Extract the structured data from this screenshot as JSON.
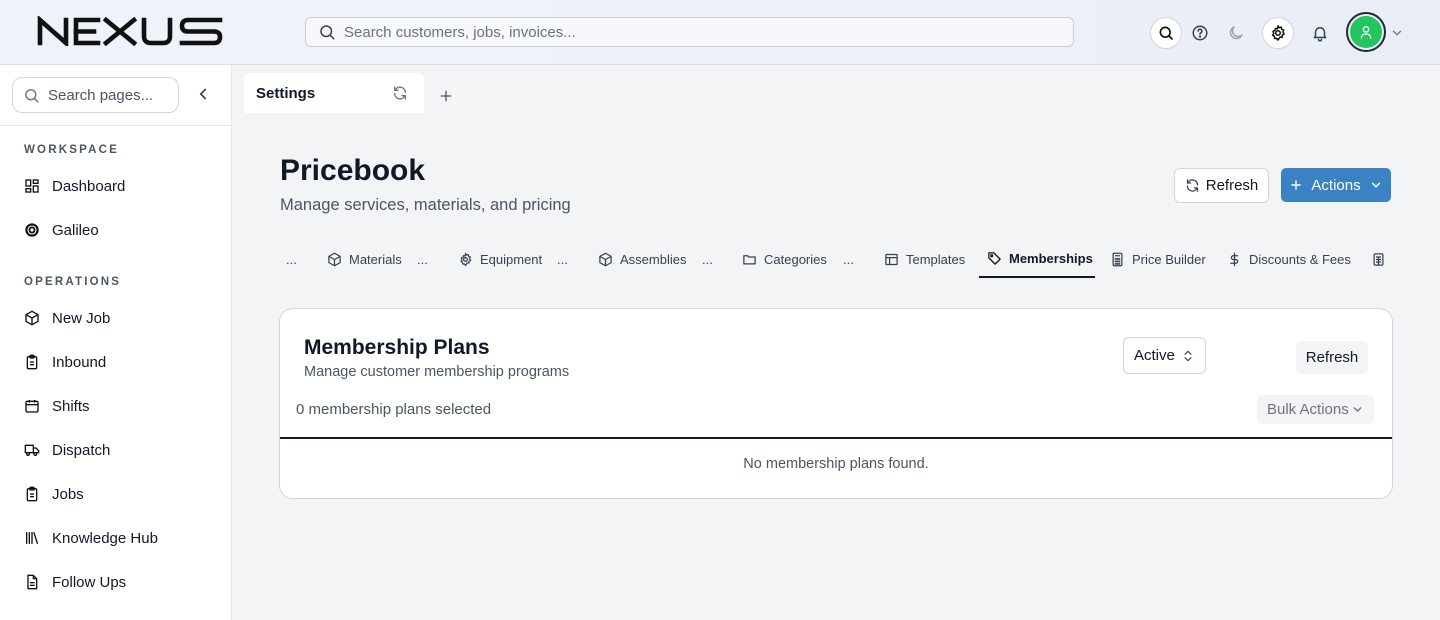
{
  "app": {
    "logo_text": "NEXUS"
  },
  "header": {
    "search_placeholder": "Search customers, jobs, invoices...",
    "icons": [
      "search-icon",
      "help-icon",
      "moon-icon",
      "gear-icon",
      "bell-icon",
      "user-icon",
      "chevron-down-icon"
    ]
  },
  "sidebar": {
    "search_placeholder": "Search pages...",
    "sections": [
      {
        "title": "WORKSPACE",
        "items": [
          {
            "label": "Dashboard",
            "icon": "dashboard-icon"
          },
          {
            "label": "Galileo",
            "icon": "galileo-icon"
          }
        ]
      },
      {
        "title": "OPERATIONS",
        "items": [
          {
            "label": "New Job",
            "icon": "box-icon"
          },
          {
            "label": "Inbound",
            "icon": "clipboard-icon"
          },
          {
            "label": "Shifts",
            "icon": "calendar-icon"
          },
          {
            "label": "Dispatch",
            "icon": "truck-icon"
          },
          {
            "label": "Jobs",
            "icon": "clipboard-icon"
          },
          {
            "label": "Knowledge Hub",
            "icon": "library-icon"
          },
          {
            "label": "Follow Ups",
            "icon": "document-icon"
          }
        ]
      }
    ]
  },
  "tabs": {
    "open_tab_label": "Settings"
  },
  "page": {
    "title": "Pricebook",
    "subtitle": "Manage services, materials, and pricing",
    "refresh_label": "Refresh",
    "actions_label": "Actions"
  },
  "subtabs": {
    "ellipsis": "...",
    "items": [
      {
        "label": "Materials",
        "icon": "box-icon"
      },
      {
        "label": "Equipment",
        "icon": "gear-icon"
      },
      {
        "label": "Assemblies",
        "icon": "box-icon"
      },
      {
        "label": "Categories",
        "icon": "folder-icon"
      },
      {
        "label": "Templates",
        "icon": "table-icon"
      },
      {
        "label": "Memberships",
        "icon": "tag-icon",
        "active": true
      },
      {
        "label": "Price Builder",
        "icon": "calculator-icon"
      },
      {
        "label": "Discounts & Fees",
        "icon": "dollar-icon"
      }
    ]
  },
  "card": {
    "title": "Membership Plans",
    "subtitle": "Manage customer membership programs",
    "status_select": "Active",
    "refresh_label": "Refresh",
    "selected_count_text": "0 membership plans selected",
    "bulk_actions_label": "Bulk Actions",
    "empty_text": "No membership plans found."
  },
  "colors": {
    "primary_button": "#3b82c4",
    "avatar_bg": "#22c55e",
    "text_primary": "#111827",
    "text_muted": "#4b5563"
  }
}
